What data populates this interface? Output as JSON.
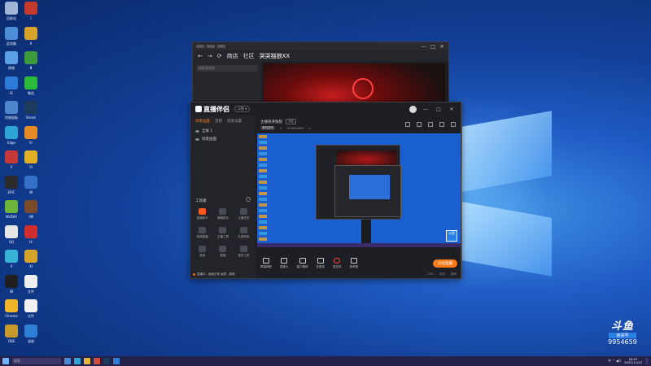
{
  "desktop": {
    "icons": [
      {
        "name": "recycle-bin-icon",
        "label": "回收站",
        "color": "#9fb6d8"
      },
      {
        "name": "app-red-icon",
        "label": "Ⅰ",
        "color": "#c43b2d"
      },
      {
        "name": "computer-icon",
        "label": "此电脑",
        "color": "#4c8fd8"
      },
      {
        "name": "app-yellow-icon",
        "label": "Ⅱ",
        "color": "#d8a32a"
      },
      {
        "name": "network-icon",
        "label": "网络",
        "color": "#5aa0e6"
      },
      {
        "name": "app-game-icon",
        "label": "Ⅲ",
        "color": "#3b9a3b"
      },
      {
        "name": "ie-icon",
        "label": "IE",
        "color": "#2e7ad9"
      },
      {
        "name": "wechat-icon",
        "label": "微信",
        "color": "#2dbb3c"
      },
      {
        "name": "control-panel-icon",
        "label": "控制面板",
        "color": "#4d86c9"
      },
      {
        "name": "steam-icon",
        "label": "Steam",
        "color": "#1b3a5c"
      },
      {
        "name": "edge-icon",
        "label": "Edge",
        "color": "#2ea3d6"
      },
      {
        "name": "app-orange-icon",
        "label": "Ⅳ",
        "color": "#e38c25"
      },
      {
        "name": "app-red2-icon",
        "label": "Ⅴ",
        "color": "#c73939"
      },
      {
        "name": "app-yellow2-icon",
        "label": "Ⅵ",
        "color": "#e1b025"
      },
      {
        "name": "epic-icon",
        "label": "EPIC",
        "color": "#2b2b2b"
      },
      {
        "name": "app-blue-icon",
        "label": "Ⅶ",
        "color": "#3370c6"
      },
      {
        "name": "nvidia-icon",
        "label": "NVIDIA",
        "color": "#6fb43a"
      },
      {
        "name": "app-face-icon",
        "label": "Ⅷ",
        "color": "#7a4b2a"
      },
      {
        "name": "qq-icon",
        "label": "QQ",
        "color": "#e6e6e6"
      },
      {
        "name": "app-red3-icon",
        "label": "Ⅸ",
        "color": "#cf2e2e"
      },
      {
        "name": "app-cyan-icon",
        "label": "Ⅹ",
        "color": "#38b3d6"
      },
      {
        "name": "app-mix-icon",
        "label": "Ⅺ",
        "color": "#d6a32b"
      },
      {
        "name": "app-black-icon",
        "label": "Ⅻ",
        "color": "#1f1f1f"
      },
      {
        "name": "file-icon",
        "label": "文件",
        "color": "#eeeeee"
      },
      {
        "name": "app-chrome-icon",
        "label": "Chrome",
        "color": "#f1b52a"
      },
      {
        "name": "file2-icon",
        "label": "文件",
        "color": "#f0f0f0"
      },
      {
        "name": "app-owl-icon",
        "label": "OBS",
        "color": "#c79a2c"
      },
      {
        "name": "app-screen-icon",
        "label": "录屏",
        "color": "#2f7fd6"
      }
    ]
  },
  "back_window": {
    "title_text": "",
    "nav": {
      "back": "←",
      "forward": "→",
      "refresh": "⟳",
      "tab1": "商店",
      "tab2": "社区",
      "tab3": "哭哭独狼XX"
    },
    "search_placeholder": "搜索游戏库",
    "controls": {
      "min": "—",
      "max": "□",
      "close": "✕"
    }
  },
  "main_window": {
    "brand": "直播伴侣",
    "badge": "斗鱼 ▾",
    "controls": {
      "min": "—",
      "max": "□",
      "close": "✕"
    },
    "tabs": {
      "scene": "场景画面",
      "audio": "音频",
      "settings": "场景设置"
    },
    "scenes": [
      {
        "label": "全屏 1"
      },
      {
        "label": "场景画面"
      }
    ],
    "room": {
      "title": "主播哭哭独狼",
      "tag": "分区",
      "category": "单机游戏",
      "game": "单机游戏",
      "room_no": "ID:9954659"
    },
    "tools_title": "工具箱",
    "tools": [
      {
        "name": "tool-live-icon",
        "label": "直播助手",
        "hot": true
      },
      {
        "name": "tool-bell-icon",
        "label": "弹幕助手",
        "hot": false
      },
      {
        "name": "tool-mic-icon",
        "label": "主播任务",
        "hot": false
      },
      {
        "name": "tool-video-icon",
        "label": "视频直播",
        "hot": false
      },
      {
        "name": "tool-person-icon",
        "label": "主播工具",
        "hot": false
      },
      {
        "name": "tool-gift-icon",
        "label": "礼物特效",
        "hot": false
      },
      {
        "name": "tool-record-icon",
        "label": "录制",
        "hot": false
      },
      {
        "name": "tool-chart-icon",
        "label": "数据",
        "hot": false
      },
      {
        "name": "tool-more-icon",
        "label": "更多工具",
        "hot": false
      }
    ],
    "status_text": "直播中，画面正常 画质：超清",
    "bottom_tools": [
      {
        "name": "screen-capture-button",
        "label": "屏幕捕获"
      },
      {
        "name": "camera-button",
        "label": "摄像头"
      },
      {
        "name": "window-capture-button",
        "label": "窗口捕获"
      },
      {
        "name": "media-button",
        "label": "多媒体"
      },
      {
        "name": "mic-button",
        "label": "麦克风"
      },
      {
        "name": "speaker-button",
        "label": "扬声器"
      }
    ],
    "start_button": "开始直播",
    "footer": [
      "CPU:",
      "内存:",
      "帧率:"
    ]
  },
  "watermark": {
    "logo": "斗鱼",
    "sub": "房间号",
    "room_number": "9954659"
  },
  "taskbar": {
    "search_placeholder": "搜索",
    "tray": "中 ⌃ ◀))",
    "time": "20:07",
    "date": "2021/11/23"
  },
  "colors": {
    "accent": "#ff7a1a",
    "wallpaper_dark": "#0b2a6b",
    "wallpaper_light": "#3f8fe3"
  }
}
